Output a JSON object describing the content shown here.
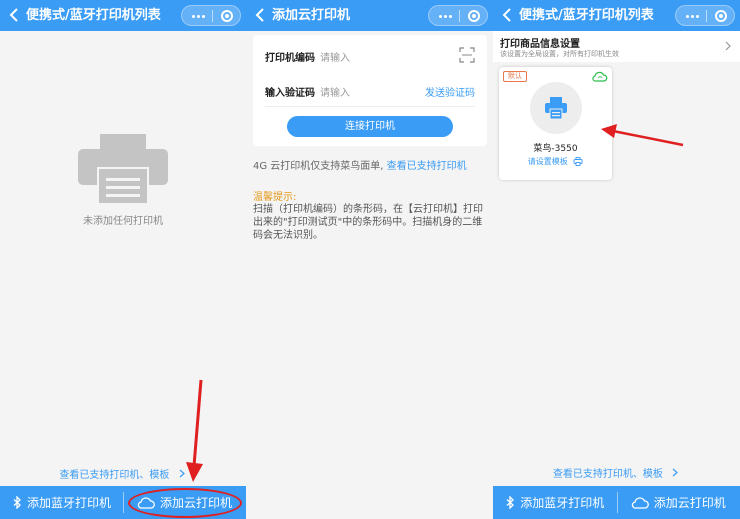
{
  "colors": {
    "brand": "#3a9cf5",
    "annotation": "#e02020",
    "tips": "#e69a1b",
    "badge": "#e8784a",
    "online": "#2bbd4e"
  },
  "screen1": {
    "title": "便携式/蓝牙打印机列表",
    "empty_text": "未添加任何打印机",
    "support_link": "查看已支持打印机、模板",
    "bottom": {
      "bluetooth_label": "添加蓝牙打印机",
      "cloud_label": "添加云打印机"
    },
    "icons": {
      "back": "chevron-left-icon",
      "menu": "more-dots-icon",
      "close": "target-icon",
      "printer": "printer-icon",
      "bluetooth": "bluetooth-icon",
      "cloud": "cloud-icon"
    }
  },
  "screen2": {
    "title": "添加云打印机",
    "code_label": "打印机编码",
    "code_placeholder": "请输入",
    "verify_label": "输入验证码",
    "verify_placeholder": "请输入",
    "send_code": "发送验证码",
    "connect": "连接打印机",
    "note": "4G 云打印机仅支持菜鸟面单,",
    "note_link": "查看已支持打印机",
    "tips_title": "温馨提示:",
    "tips_body": "扫描（打印机编码）的条形码，在【云打印机】打印出来的\"打印测试页\"中的条形码中。扫描机身的二维码会无法识别。",
    "icons": {
      "scan": "scan-icon"
    }
  },
  "screen3": {
    "title": "便携式/蓝牙打印机列表",
    "setting_title": "打印商品信息设置",
    "setting_desc": "该设置为全局设置，对所有打印机生效",
    "printer": {
      "badge": "默认",
      "name": "菜鸟-3550",
      "template": "请设置模板"
    },
    "support_link": "查看已支持打印机、模板",
    "bottom": {
      "bluetooth_label": "添加蓝牙打印机",
      "cloud_label": "添加云打印机"
    },
    "icons": {
      "online": "cloud-online-icon",
      "template": "printer-small-icon",
      "chevron": "chevron-right-icon"
    }
  }
}
